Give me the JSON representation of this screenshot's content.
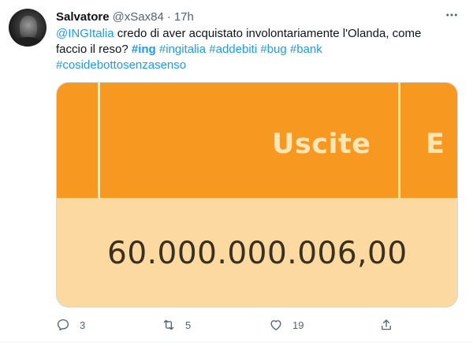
{
  "tweet": {
    "author": {
      "display_name": "Salvatore",
      "handle": "@xSax84",
      "separator": "·",
      "time": "17h"
    },
    "text": {
      "mention": "@INGItalia",
      "line1_rest": " credo di aver acquistato involontariamente l'Olanda, come",
      "line2_plain": "faccio il reso? ",
      "hashtags_line2": [
        "#ing",
        "#ingitalia",
        "#addebiti",
        "#bug",
        "#bank"
      ],
      "hashtag_line3": "#cosidebottosenzasenso"
    },
    "media": {
      "column_header": "Uscite",
      "column_header_next": "E",
      "amount": "60.000.000.006,00",
      "colors": {
        "header_band": "#f79820",
        "body_band": "#fbd9a0",
        "divider": "#ffe7a6"
      }
    },
    "actions": {
      "reply": {
        "icon": "reply-icon",
        "count": "3"
      },
      "retweet": {
        "icon": "retweet-icon",
        "count": "5"
      },
      "like": {
        "icon": "heart-icon",
        "count": "19"
      },
      "share": {
        "icon": "share-icon",
        "count": ""
      }
    },
    "accent_color": "#1d9bf0"
  }
}
